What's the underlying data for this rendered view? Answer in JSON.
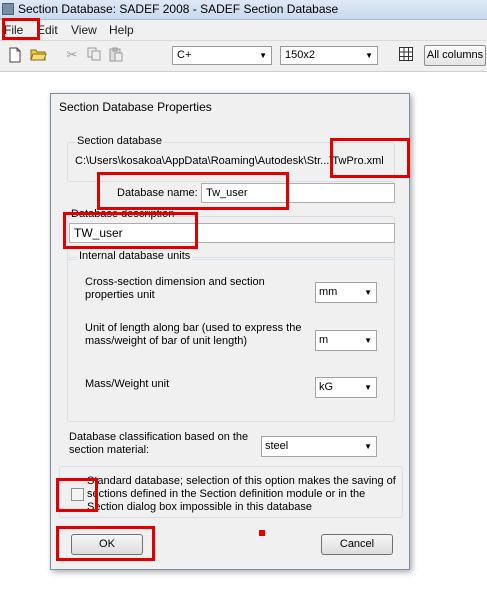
{
  "window": {
    "title": "Section Database: SADEF 2008 - SADEF Section Database"
  },
  "menu": {
    "items": [
      "File",
      "Edit",
      "View",
      "Help"
    ]
  },
  "toolbar": {
    "icons": [
      "new-file-icon",
      "open-folder-icon",
      "cut-icon",
      "copy-icon",
      "paste-icon"
    ],
    "standard_value": "C+",
    "profile_value": "150x2",
    "all_columns_label": "All columns"
  },
  "dialog": {
    "title": "Section Database Properties",
    "section_database_legend": "Section database",
    "path": "C:\\Users\\kosakoa\\AppData\\Roaming\\Autodesk\\Str...\\TwPro.xml",
    "database_name_label": "Database name:",
    "database_name_value": "Tw_user",
    "database_description_legend": "Database description",
    "database_description_value": "TW_user",
    "units_legend": "Internal database units",
    "unit_cross_section_label": "Cross-section dimension and section properties unit",
    "unit_cross_section_value": "mm",
    "unit_length_label": "Unit of length along bar (used to express the mass/weight of bar of unit length)",
    "unit_length_value": "m",
    "unit_mass_label": "Mass/Weight unit",
    "unit_mass_value": "kG",
    "classification_label": "Database classification based on the section material:",
    "classification_value": "steel",
    "standard_label": "Standard database; selection of this option makes the saving of sections defined in the Section definition module or in the Section dialog box impossible in this database",
    "ok_label": "OK",
    "cancel_label": "Cancel"
  },
  "colors": {
    "annotation": "#e00000",
    "dialog_bg": "#f0f0f0"
  }
}
